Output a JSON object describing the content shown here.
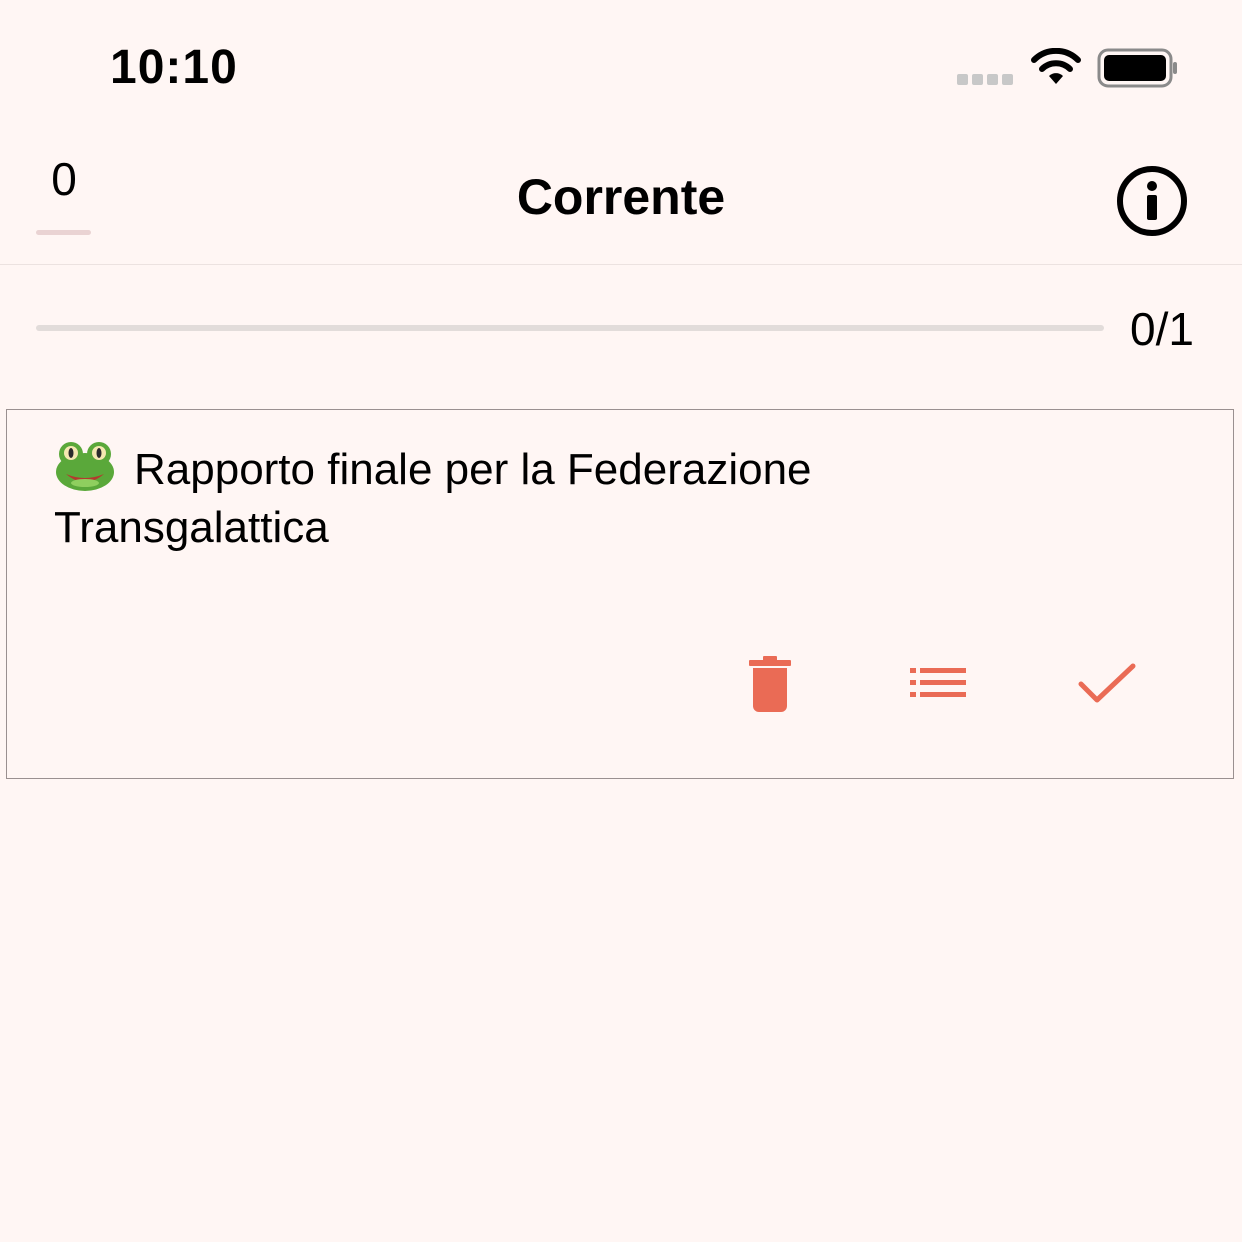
{
  "status_bar": {
    "time": "10:10",
    "icons": [
      "signal-dots-icon",
      "wifi-icon",
      "battery-icon"
    ]
  },
  "nav": {
    "counter": "0",
    "title": "Corrente",
    "info_icon": "info-circle-icon"
  },
  "progress": {
    "label": "0/1",
    "completed": 0,
    "total": 1,
    "fraction": 0
  },
  "task": {
    "emoji_icon": "frog-emoji",
    "title": "Rapporto finale per la Federazione Transgalattica",
    "actions": {
      "delete_icon": "trash-icon",
      "details_icon": "list-icon",
      "complete_icon": "checkmark-icon"
    }
  },
  "colors": {
    "background": "#fff6f4",
    "accent": "#ea6b55",
    "text": "#000000",
    "progress_track": "#e2dcda"
  }
}
